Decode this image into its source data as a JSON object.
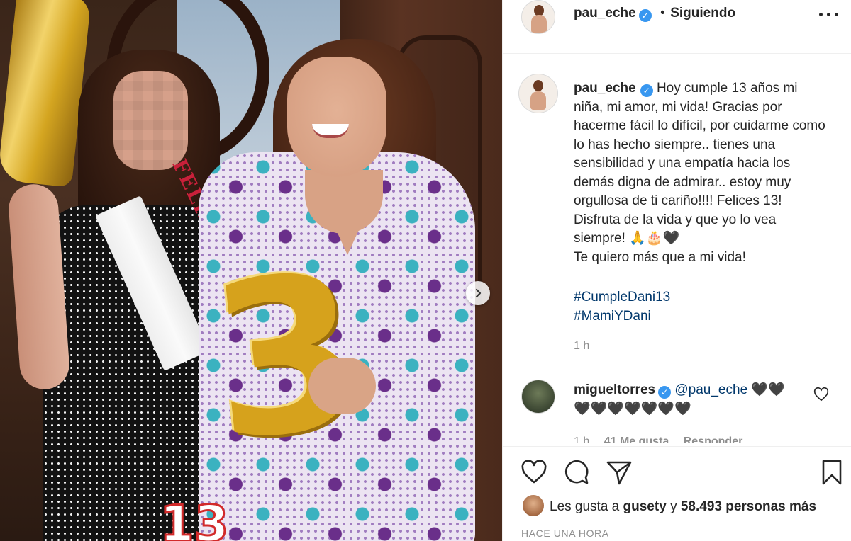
{
  "post_header": {
    "username": "pau_eche",
    "separator": "•",
    "follow_status": "Siguiendo"
  },
  "caption": {
    "username": "pau_eche",
    "text": "Hoy cumple 13 años mi niña, mi amor, mi vida! Gracias por hacerme fácil lo difícil, por cuidarme como lo has hecho siempre.. tienes una sensibilidad y una empatía hacia los demás digna de admirar.. estoy muy orgullosa de ti cariño!!!! Felices 13! Disfruta de la vida y que yo lo vea siempre! 🙏🎂🖤",
    "line2": "Te quiero más que a mi vida!",
    "hashtags": [
      "#CumpleDani13",
      "#MamiYDani"
    ],
    "age": "1 h"
  },
  "comment": {
    "username": "migueltorres",
    "mention": "@pau_eche",
    "text_after_mention": " 🖤🖤",
    "line2": "🖤🖤🖤🖤🖤🖤🖤",
    "meta": {
      "age": "1 h",
      "likes": "41 Me gusta",
      "reply": "Responder"
    }
  },
  "photo": {
    "sash_text": "FELIZ CUM",
    "balloon_digit": "3",
    "candle_text": "13"
  },
  "likes": {
    "prefix": "Les gusta a",
    "user": "gusety",
    "conjunction": "y",
    "count": "58.493 personas más"
  },
  "timestamp": "HACE UNA HORA",
  "icons": [
    "verified-badge-icon",
    "more-options-icon",
    "heart-icon",
    "comment-icon",
    "share-icon",
    "bookmark-icon",
    "chevron-right-icon"
  ],
  "colors": {
    "verified": "#3897f0",
    "link": "#00376b",
    "muted": "#8e8e8e",
    "text": "#262626"
  }
}
